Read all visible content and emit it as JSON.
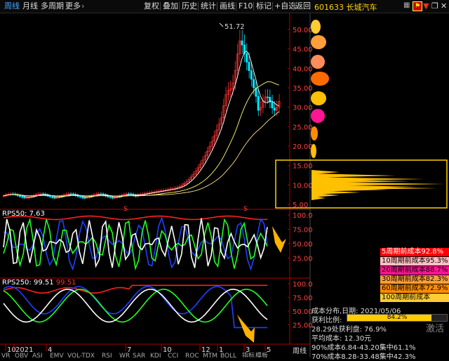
{
  "toolbar": {
    "left": [
      "周线",
      "月线",
      "多周期",
      "更多"
    ],
    "right": [
      "复权",
      "叠加",
      "历史",
      "统计",
      "画线",
      "F10",
      "标记",
      "+自选",
      "返回"
    ],
    "stock_code": "601633",
    "stock_name": "长城汽车"
  },
  "main_chart": {
    "high_label": "51.72",
    "y_ticks": [
      "50.00",
      "45.00",
      "40.00",
      "35.00",
      "30.00",
      "25.00",
      "20.00",
      "15.00",
      "10.00",
      "5.00"
    ],
    "marker": "S"
  },
  "rps1": {
    "title": "RPS50: 7.63",
    "y_ticks": [
      "100.0",
      "75.00",
      "50.00",
      "25.00"
    ]
  },
  "rps2": {
    "title": "RPS250: 99.51",
    "title_red": "99.51",
    "y_ticks": [
      "100.0",
      "75.00",
      "50.00",
      "25.00"
    ]
  },
  "time_axis": {
    "labels": [
      "10",
      "2021",
      "4",
      "7",
      "10",
      "12",
      "1",
      "3",
      "5"
    ],
    "period": "周线"
  },
  "bottom_tabs": [
    "VR",
    "OBV",
    "ASI",
    "EMV",
    "VOL-TDX",
    "RSI",
    "WR",
    "SAR",
    "KDJ",
    "CCI",
    "ROC",
    "MTM",
    "BOLL",
    "指标",
    "模板"
  ],
  "cost_table": [
    {
      "label": "5周期前成本92.8%",
      "bg": "#ff0000",
      "color": "#ffffff"
    },
    {
      "label": "10周期前成本95.3%",
      "bg": "#ffc0c0",
      "color": "#000000"
    },
    {
      "label": "20周期前成本88.7%",
      "bg": "#ff1493",
      "color": "#000000"
    },
    {
      "label": "30周期前成本82.3%",
      "bg": "#ff9e3a",
      "color": "#000000"
    },
    {
      "label": "60周期前成本72.9%",
      "bg": "#ff8c00",
      "color": "#000000"
    },
    {
      "label": "100周期前成本62.3%",
      "bg": "#ffcc33",
      "color": "#000000"
    }
  ],
  "cost_info": {
    "date_line": "成本分布,日期: 2021/05/06",
    "profit_label": "获利比例:",
    "profit_value": "84.2%",
    "profit_fraction": 0.842,
    "line1": "28.29处获利盘: 76.9%",
    "line2": "平均成本: 12.30元",
    "line3": "90%成本6.84-43.20集中61.1%",
    "line4": "70%成本8.28-33.48集中42.3%"
  },
  "watermark": "激活",
  "colors": {
    "up": "#ff3333",
    "down": "#00e5ff",
    "ma1": "#ffffff",
    "ma2": "#ffff66",
    "ma3": "#ffe08a",
    "accent": "#ffd000"
  }
}
